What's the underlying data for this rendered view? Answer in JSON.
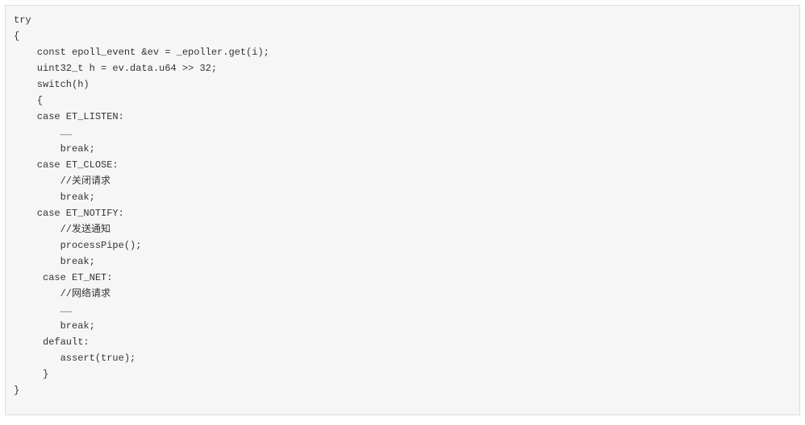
{
  "code": {
    "lines": [
      "try",
      "{",
      "    const epoll_event &ev = _epoller.get(i);",
      "    uint32_t h = ev.data.u64 >> 32;",
      "",
      "    switch(h)",
      "    {",
      "    case ET_LISTEN:",
      "        ……",
      "        break;",
      "    case ET_CLOSE:",
      "        //关闭请求",
      "        break;",
      "    case ET_NOTIFY:",
      "        //发送通知",
      "        processPipe();",
      "        break;",
      "     case ET_NET:",
      "        //网络请求",
      "        ……",
      "        break;",
      "     default:",
      "        assert(true);",
      "     }",
      "}"
    ]
  }
}
